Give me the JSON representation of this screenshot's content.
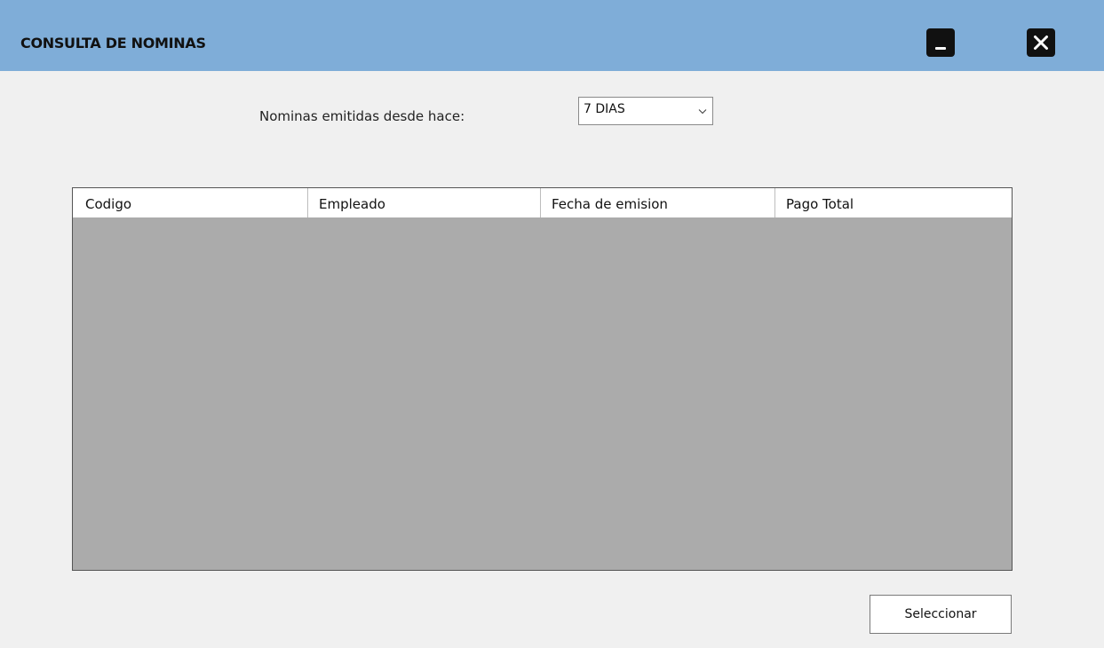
{
  "window": {
    "title": "CONSULTA DE NOMINAS",
    "minimize_icon": "minimize-icon",
    "close_icon": "close-icon"
  },
  "filter": {
    "label": "Nominas emitidas desde hace:",
    "selected": "7 DIAS",
    "icon": "chevron-down-icon"
  },
  "table": {
    "columns": [
      "Codigo",
      "Empleado",
      "Fecha de emision",
      "Pago Total"
    ],
    "rows": []
  },
  "actions": {
    "select_label": "Seleccionar"
  },
  "colors": {
    "titlebar": "#7fadd8",
    "background": "#f0f0f0",
    "grid_empty": "#ababab"
  }
}
